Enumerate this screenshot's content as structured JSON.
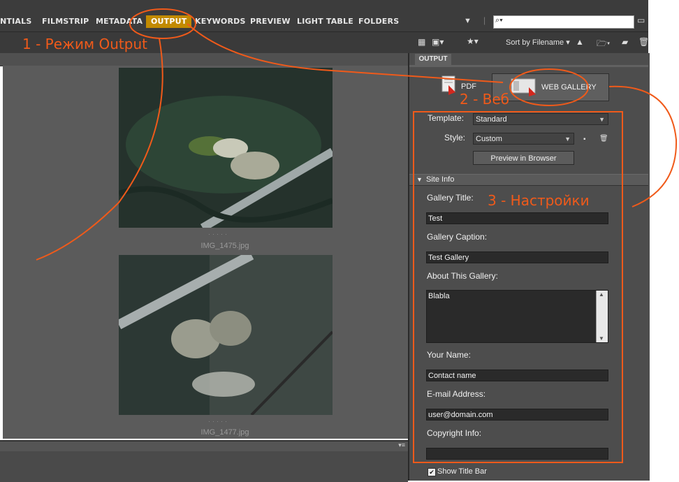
{
  "tabs": [
    {
      "label": "NTIALS"
    },
    {
      "label": "FILMSTRIP"
    },
    {
      "label": "METADATA"
    },
    {
      "label": "OUTPUT"
    },
    {
      "label": "KEYWORDS"
    },
    {
      "label": "PREVIEW"
    },
    {
      "label": "LIGHT TABLE"
    },
    {
      "label": "FOLDERS"
    }
  ],
  "search": {
    "icon": "search-icon",
    "value": ""
  },
  "toolbar": {
    "sort_label": "Sort by Filename"
  },
  "thumbnails": [
    {
      "caption": "IMG_1475.jpg"
    },
    {
      "caption": "IMG_1477.jpg"
    }
  ],
  "output_panel": {
    "tab_label": "OUTPUT",
    "pdf_label": "PDF",
    "web_gallery_label": "WEB GALLERY",
    "template_label": "Template:",
    "template_value": "Standard",
    "style_label": "Style:",
    "style_value": "Custom",
    "preview_button": "Preview in Browser",
    "site_info_label": "Site Info",
    "fields": {
      "gallery_title_label": "Gallery Title:",
      "gallery_title_value": "Test",
      "gallery_caption_label": "Gallery Caption:",
      "gallery_caption_value": "Test Gallery",
      "about_label": "About This Gallery:",
      "about_value": "Blabla",
      "your_name_label": "Your Name:",
      "your_name_value": "Contact name",
      "email_label": "E-mail Address:",
      "email_value": "user@domain.com",
      "copyright_label": "Copyright Info:",
      "copyright_value": ""
    },
    "show_title_bar_label": "Show Title Bar",
    "show_title_bar_checked": true
  },
  "annotations": {
    "note1": "1 - Режим Output",
    "note2": "2 - Веб",
    "note3": "3 - Настройки",
    "color": "#f05a1a"
  },
  "colors": {
    "active_tab": "#c28a00",
    "panel_bg": "#4d4d4d"
  }
}
